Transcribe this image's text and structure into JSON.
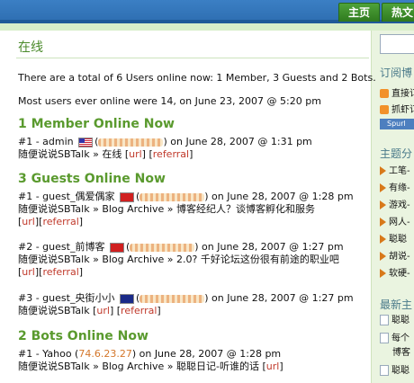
{
  "nav": {
    "home": "主页",
    "hot": "热文"
  },
  "page": {
    "title": "在线",
    "summary": "There are a total of 6 Users online now: 1 Member, 3 Guests and 2 Bots.",
    "most": "Most users ever online were 14, on June 23, 2007 @ 5:20 pm"
  },
  "members": {
    "heading": "1 Member Online Now",
    "items": [
      {
        "prefix": "#1 - admin",
        "time": " on June 28, 2007 @ 1:31 pm",
        "loc": "随便说说SBTalk » 在线 [",
        "url": "url",
        "referral": "referral",
        "tail": "]"
      }
    ]
  },
  "guests": {
    "heading": "3 Guests Online Now",
    "items": [
      {
        "prefix": "#1 - guest_偶爱偶家",
        "time": " on June 28, 2007 @ 1:28 pm",
        "loc": "随便说说SBTalk » Blog Archive » 博客经纪人？谈博客孵化和服务",
        "url": "url",
        "referral": "referral"
      },
      {
        "prefix": "#2 - guest_前博客",
        "time": " on June 28, 2007 @ 1:27 pm",
        "loc": "随便说说SBTalk » Blog Archive » 2.0? 千好论坛这份很有前途的职业吧",
        "url": "url",
        "referral": "referral"
      },
      {
        "prefix": "#3 - guest_央街小小",
        "time": " on June 28, 2007 @ 1:27 pm",
        "loc": "随便说说SBTalk [",
        "url": "url",
        "referral": "referral"
      }
    ]
  },
  "bots": {
    "heading": "2 Bots Online Now",
    "items": [
      {
        "prefix": "#1 - Yahoo (",
        "ip": "74.6.23.27",
        "time": ") on June 28, 2007 @ 1:28 pm",
        "loc": "随便说说SBTalk » Blog Archive » 聪聪日记-听谁的话 [",
        "url": "url"
      }
    ]
  },
  "sidebar": {
    "subscribe": "订阅博",
    "feeds": [
      "直接订",
      "抓虾订"
    ],
    "spbtn": "Spurl",
    "topics_heading": "主题分",
    "topics": [
      "工笔-",
      "有缘-",
      "游戏-",
      "网人-",
      "聪聪",
      "胡说-",
      "软硬-"
    ],
    "recent_heading": "最新主",
    "recent": [
      "聪聪",
      "每个",
      "博客",
      "聪聪"
    ]
  }
}
